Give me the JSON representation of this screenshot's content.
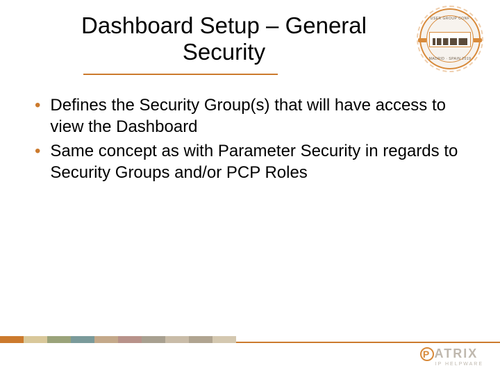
{
  "title": "Dashboard Setup – General Security",
  "bullets": [
    "Defines the Security Group(s) that will have access to view the Dashboard",
    "Same concept as with Parameter Security in regards to Security Groups and/or PCP Roles"
  ],
  "badge": {
    "top_text": "USER GROUP CONF",
    "bottom_text": "MADRID · SPAIN 2019"
  },
  "logo": {
    "letter": "P",
    "rest": "ATRIX",
    "sub": "IP HELPWARE"
  },
  "stripe_colors": [
    "#cc7a2d",
    "#d9c89a",
    "#9aa37a",
    "#7a9a9a",
    "#c4a98a",
    "#b8928a",
    "#a8a090",
    "#c9bca8",
    "#b0a490",
    "#d4c8b0"
  ]
}
